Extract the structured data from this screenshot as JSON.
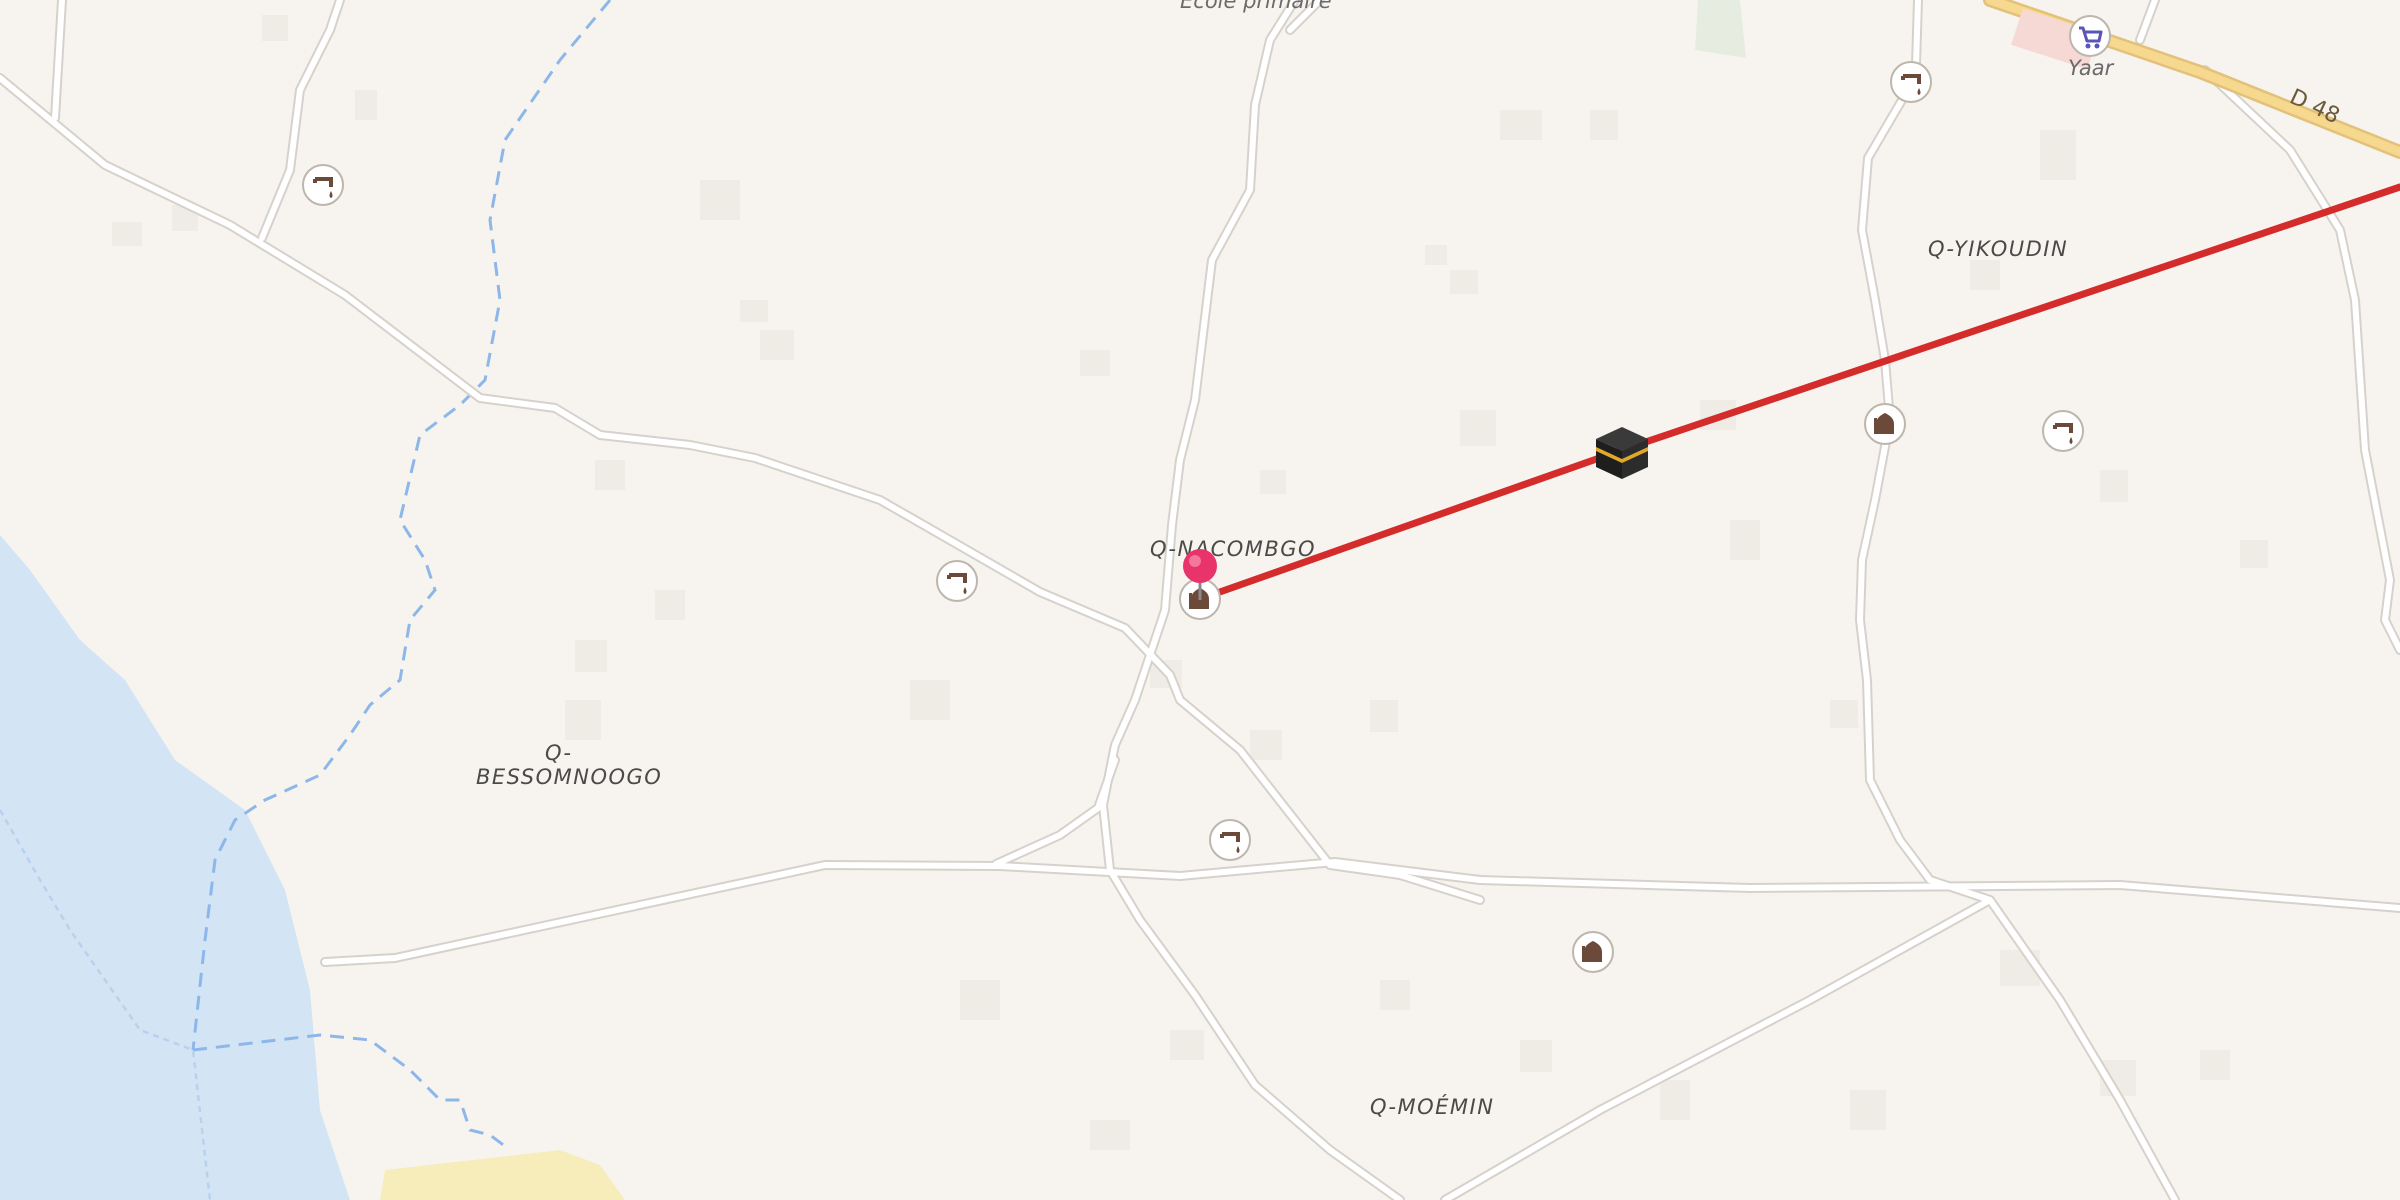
{
  "map": {
    "place_labels": {
      "ecole": "École primaire",
      "yaar": "Yaar",
      "road_d48": "D 48",
      "q_yikoudin": "Q-YIKOUDIN",
      "q_nacombgo": "Q-NACOMBGO",
      "q_bessomnoogo_line1": "Q-",
      "q_bessomnoogo_line2": "BESSOMNOOGO",
      "q_moemin": "Q-MOÉMIN"
    },
    "route": {
      "color": "#d42b2b"
    },
    "marker": {
      "color": "#e8336b"
    },
    "colors": {
      "land": "#f7f4ef",
      "water": "#d3e4f5",
      "road": "#ffffff",
      "road_casing": "#d8d4cd",
      "primary_road": "#f6d98f",
      "sand": "#f6edbb"
    },
    "poi_icons": [
      "water-tap-icon",
      "mosque-icon",
      "shop-icon",
      "kaaba-icon"
    ]
  }
}
